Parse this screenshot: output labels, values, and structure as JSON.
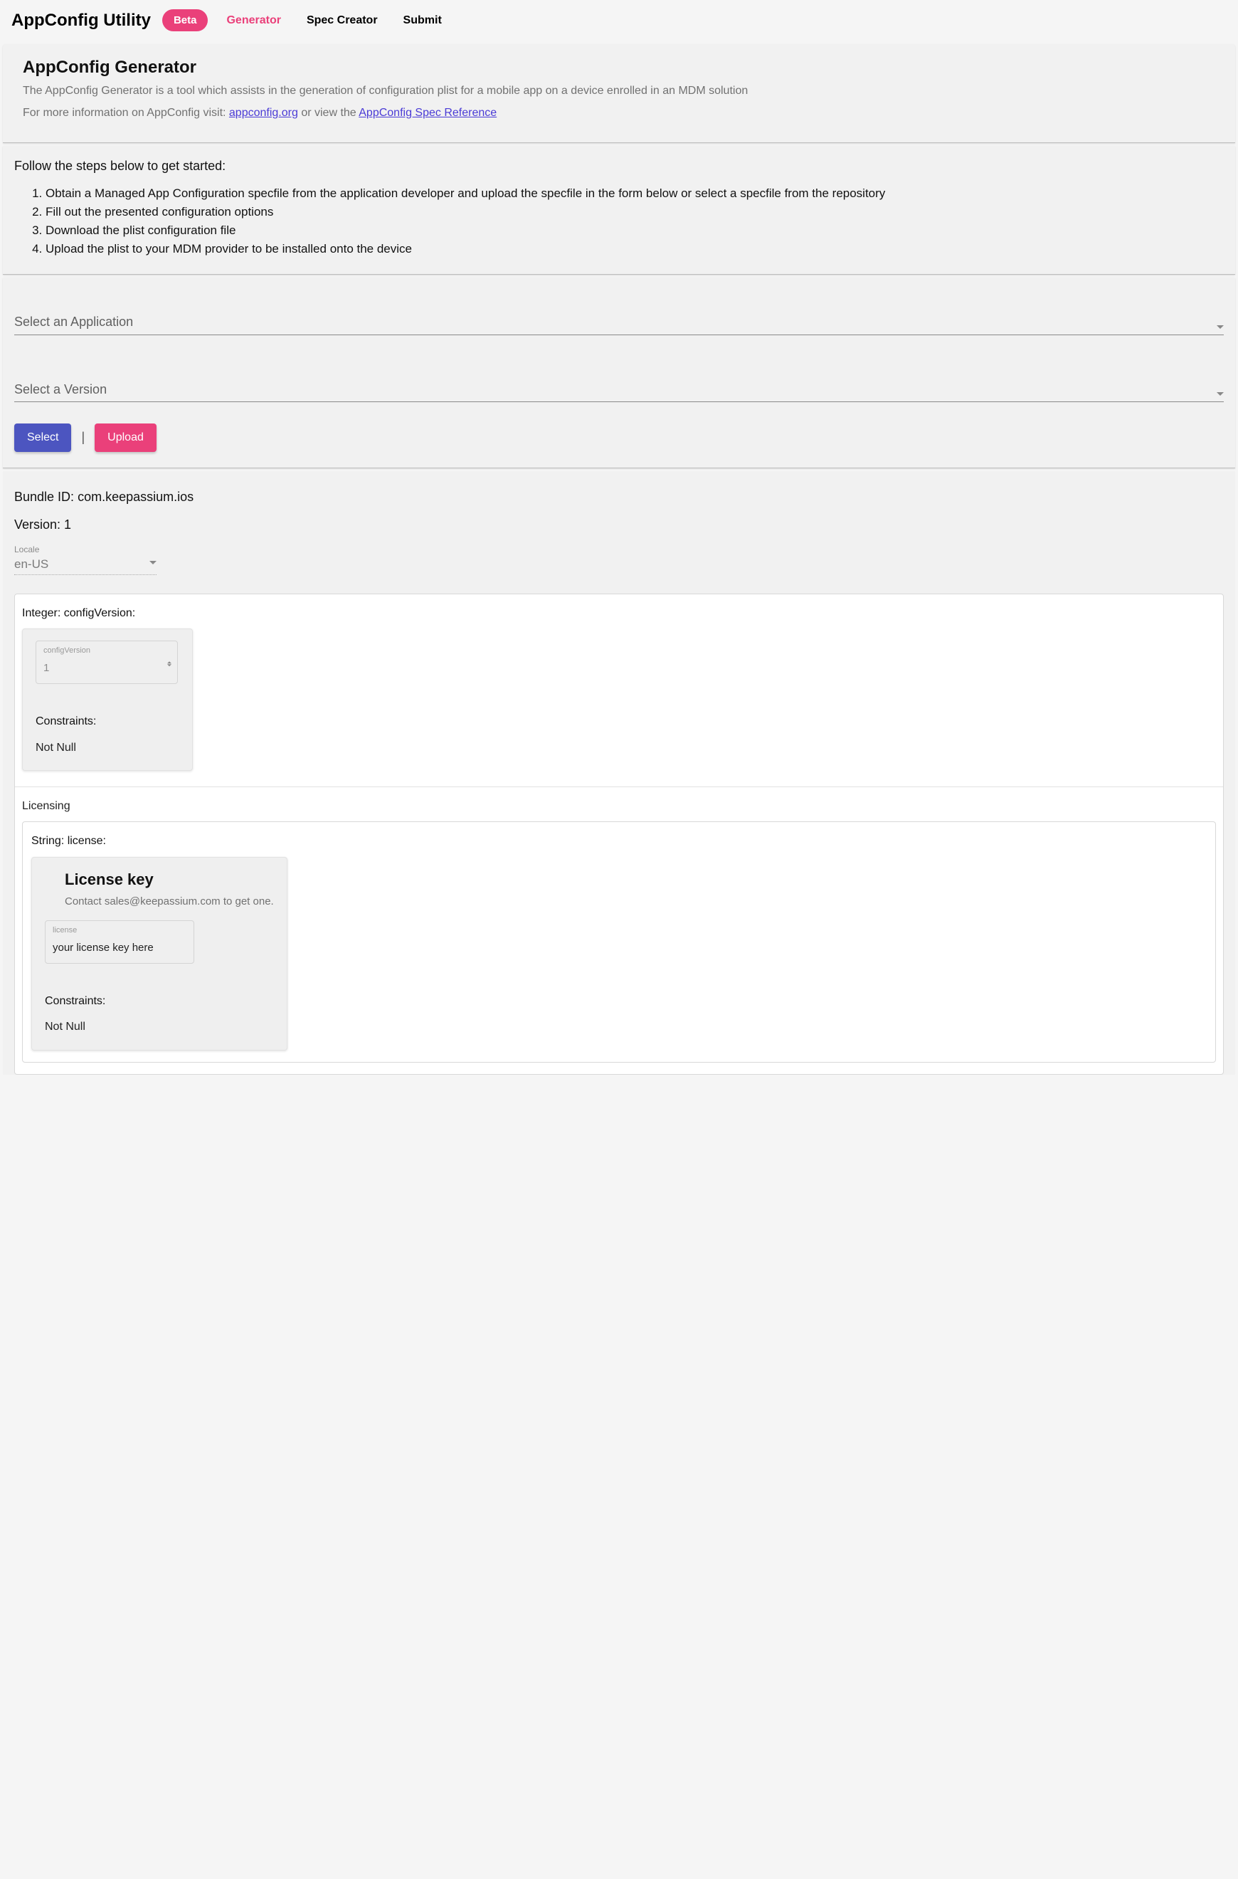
{
  "nav": {
    "title": "AppConfig Utility",
    "badge": "Beta",
    "links": [
      "Generator",
      "Spec Creator",
      "Submit"
    ],
    "active": "Generator"
  },
  "header": {
    "title": "AppConfig Generator",
    "subtitle": "The AppConfig Generator is a tool which assists in the generation of configuration plist for a mobile app on a device enrolled in an MDM solution",
    "info_pre": "For more information on AppConfig visit: ",
    "link1": "appconfig.org",
    "info_mid": " or view the ",
    "link2": "AppConfig Spec Reference"
  },
  "steps": {
    "lead": "Follow the steps below to get started:",
    "items": [
      "Obtain a Managed App Configuration specfile from the application developer and upload the specfile in the form below or select a specfile from the repository",
      "Fill out the presented configuration options",
      "Download the plist configuration file",
      "Upload the plist to your MDM provider to be installed onto the device"
    ]
  },
  "selects": {
    "app_placeholder": "Select an Application",
    "ver_placeholder": "Select a Version",
    "btn_select": "Select",
    "btn_upload": "Upload"
  },
  "form": {
    "bundle_label": "Bundle ID: ",
    "bundle_value": "com.keepassium.ios",
    "version_label": "Version: ",
    "version_value": "1",
    "locale_label": "Locale",
    "locale_value": "en-US",
    "integer_field_title": "Integer: configVersion:",
    "configVersion_label": "configVersion",
    "configVersion_value": "1",
    "constraints_h": "Constraints:",
    "constraints_v": "Not Null",
    "licensing_group": "Licensing",
    "license_field_title": "String: license:",
    "license_title": "License key",
    "license_sub": "Contact sales@keepassium.com to get one.",
    "license_input_label": "license",
    "license_input_value": "your license key here"
  }
}
